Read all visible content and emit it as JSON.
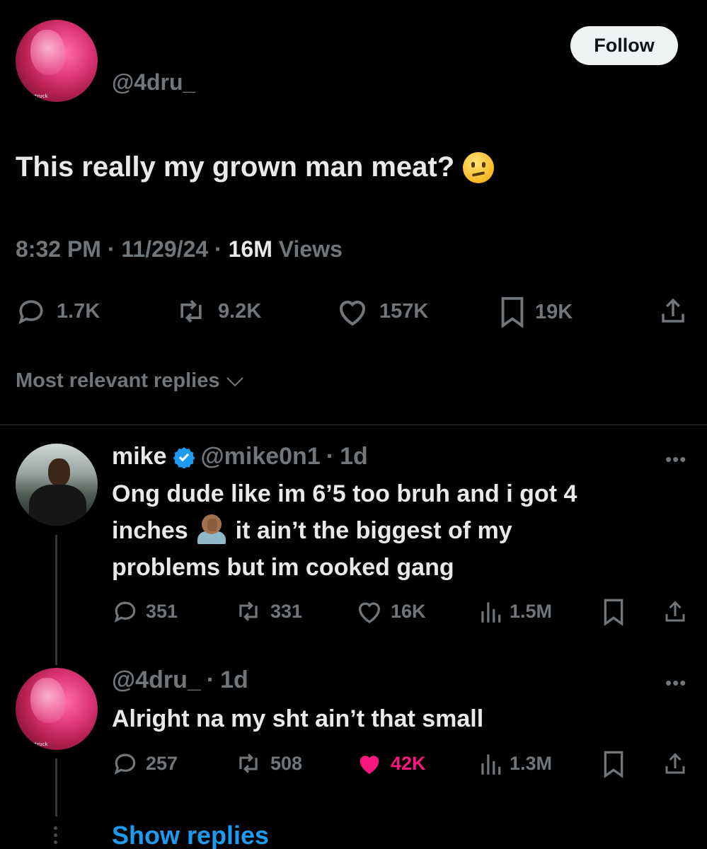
{
  "main_tweet": {
    "handle": "@4dru_",
    "avatar_caption": "struck",
    "follow_label": "Follow",
    "text": "This really my grown man meat?",
    "emoji": "confused-face",
    "time": "8:32 PM",
    "date": "11/29/24",
    "views_count": "16M",
    "views_label": "Views",
    "actions": {
      "replies": "1.7K",
      "reposts": "9.2K",
      "likes": "157K",
      "bookmarks": "19K"
    },
    "sort_label": "Most relevant replies"
  },
  "replies": [
    {
      "name": "mike",
      "verified": true,
      "handle": "@mike0n1",
      "age": "1d",
      "text_line1": "Ong dude like im 6’5 too bruh and i got 4",
      "text_line2a": "inches",
      "text_line2b": "it ain’t the biggest of my",
      "text_line3": "problems but im cooked gang",
      "stats": {
        "replies": "351",
        "reposts": "331",
        "likes": "16K",
        "views": "1.5M"
      }
    },
    {
      "handle": "@4dru_",
      "age": "1d",
      "avatar_caption": "struck",
      "text": "Alright na my sht ain’t that small",
      "stats": {
        "replies": "257",
        "reposts": "508",
        "likes": "42K",
        "views": "1.3M"
      },
      "liked": true
    }
  ],
  "show_replies_label": "Show replies",
  "colors": {
    "background": "#000000",
    "text": "#e7e9ea",
    "muted": "#71767b",
    "link": "#1d9bf0",
    "like_active": "#f91880",
    "verified": "#1d9bf0"
  },
  "icons": [
    "reply-icon",
    "repost-icon",
    "like-icon",
    "bookmark-icon",
    "share-icon",
    "views-icon",
    "verified-icon",
    "more-icon",
    "chevron-down-icon"
  ]
}
